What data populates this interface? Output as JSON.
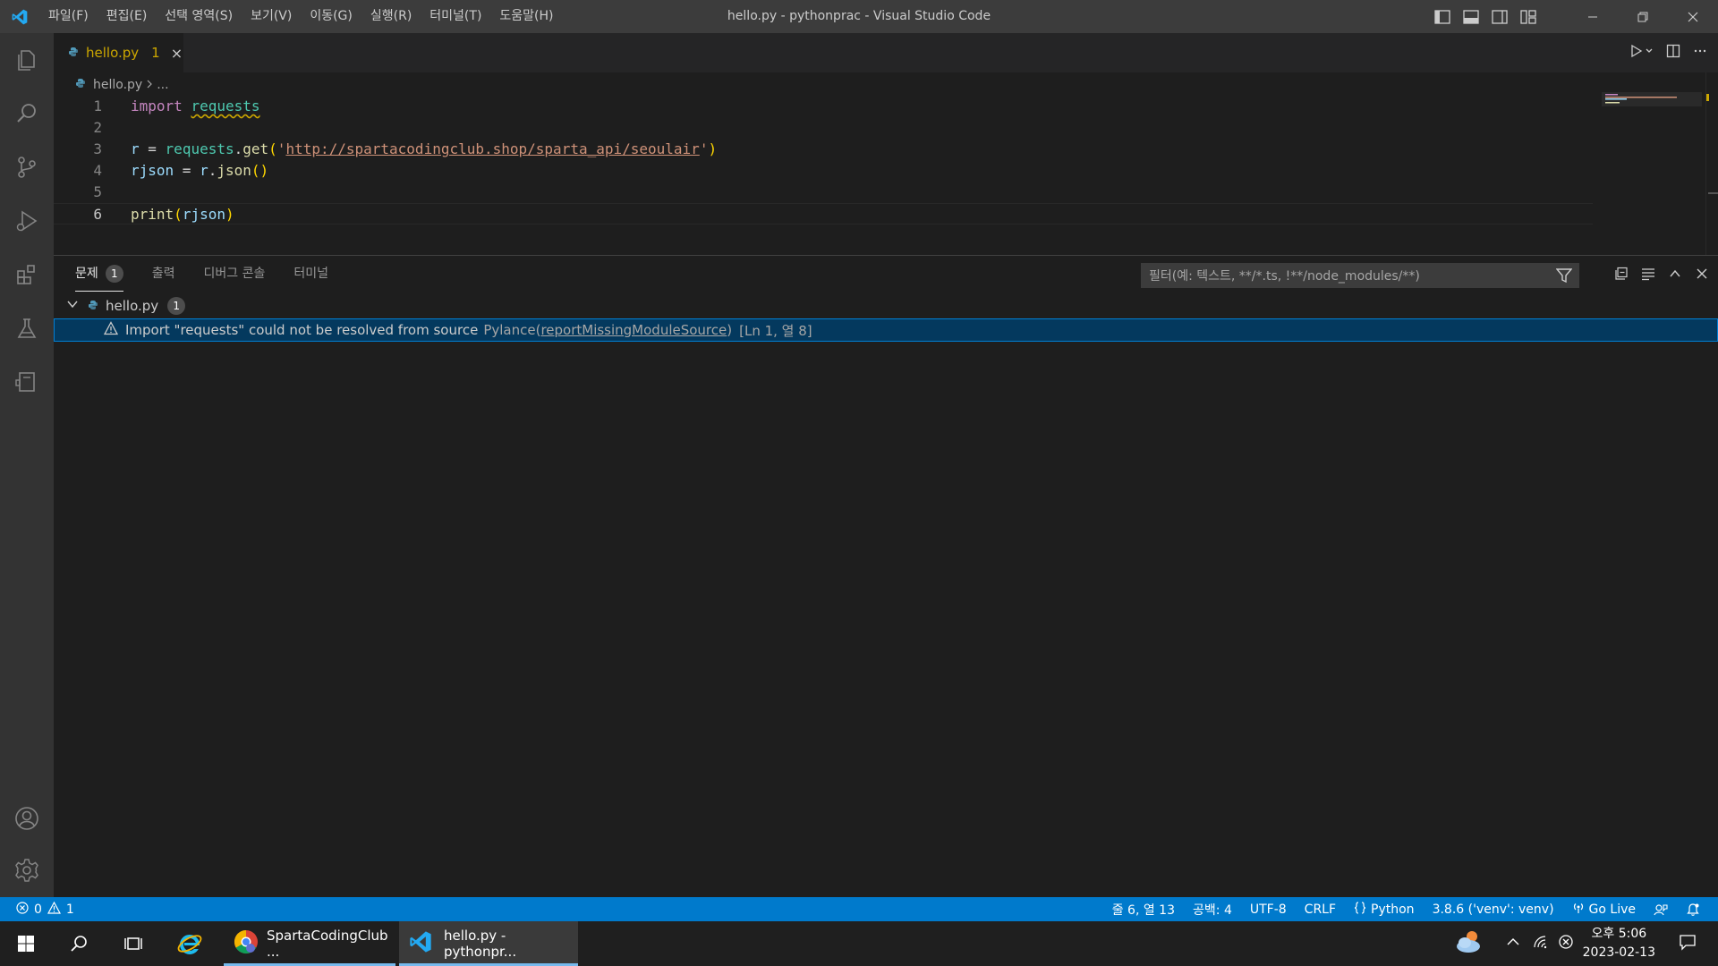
{
  "titlebar": {
    "title": "hello.py - pythonprac - Visual Studio Code",
    "menu": [
      "파일(F)",
      "편집(E)",
      "선택 영역(S)",
      "보기(V)",
      "이동(G)",
      "실행(R)",
      "터미널(T)",
      "도움말(H)"
    ]
  },
  "activitybar": {
    "items": [
      "explorer-icon",
      "search-icon",
      "source-control-icon",
      "run-debug-icon",
      "extensions-icon",
      "testing-icon",
      "remote-explorer-icon"
    ],
    "bottom": [
      "accounts-icon",
      "settings-gear-icon"
    ]
  },
  "editor": {
    "tab": {
      "name": "hello.py",
      "problems": "1",
      "close": "×"
    },
    "breadcrumb": {
      "file": "hello.py",
      "rest": "..."
    },
    "lines": [
      {
        "num": "1"
      },
      {
        "num": "2"
      },
      {
        "num": "3"
      },
      {
        "num": "4"
      },
      {
        "num": "5"
      },
      {
        "num": "6"
      }
    ],
    "code": {
      "l1_kw": "import",
      "l1_mod": "requests",
      "l3_var": "r",
      "l3_eq": " = ",
      "l3_obj": "requests",
      "l3_dot": ".",
      "l3_fn": "get",
      "l3_open": "(",
      "l3_q1": "'",
      "l3_url": "http://spartacodingclub.shop/sparta_api/seoulair",
      "l3_q2": "'",
      "l3_close": ")",
      "l4_var": "rjson",
      "l4_eq": " = ",
      "l4_obj": "r",
      "l4_dot": ".",
      "l4_fn": "json",
      "l4_parens": "()",
      "l6_fn": "print",
      "l6_open": "(",
      "l6_arg": "rjson",
      "l6_close": ")"
    }
  },
  "panel": {
    "tabs": [
      {
        "label": "문제",
        "badge": "1"
      },
      {
        "label": "출력"
      },
      {
        "label": "디버그 콘솔"
      },
      {
        "label": "터미널"
      }
    ],
    "filter_placeholder": "필터(예: 텍스트, **/*.ts, !**/node_modules/**)",
    "file": {
      "name": "hello.py",
      "count": "1"
    },
    "problem": {
      "message": "Import \"requests\" could not be resolved from source",
      "source": "Pylance(",
      "code": "reportMissingModuleSource",
      "source_close": ")",
      "position": "[Ln 1, 열 8]"
    }
  },
  "statusbar": {
    "errors": "0",
    "warnings": "1",
    "cursor": "줄 6, 열 13",
    "spaces": "공백: 4",
    "encoding": "UTF-8",
    "eol": "CRLF",
    "language": "Python",
    "interpreter": "3.8.6 ('venv': venv)",
    "golive": "Go Live"
  },
  "taskbar": {
    "apps": [
      {
        "label": "SpartaCodingClub ..."
      },
      {
        "label": "hello.py - pythonpr..."
      }
    ],
    "time": "오후 5:06",
    "date": "2023-02-13"
  },
  "colors": {
    "accent": "#007acc",
    "warning": "#cca700",
    "selection": "#04395e"
  }
}
